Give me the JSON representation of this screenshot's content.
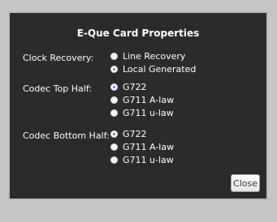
{
  "dialog": {
    "title": "E-Que Card Properties"
  },
  "clock_recovery": {
    "label": "Clock Recovery:",
    "options": [
      {
        "label": "Line Recovery",
        "selected": false
      },
      {
        "label": "Local Generated",
        "selected": true
      }
    ]
  },
  "codec_top_half": {
    "label": "Codec Top Half:",
    "options": [
      {
        "label": "G722",
        "selected": true
      },
      {
        "label": "G711 A-law",
        "selected": false
      },
      {
        "label": "G711 u-law",
        "selected": false
      }
    ]
  },
  "codec_bottom_half": {
    "label": "Codec Bottom Half:",
    "options": [
      {
        "label": "G722",
        "selected": true
      },
      {
        "label": "G711 A-law",
        "selected": false
      },
      {
        "label": "G711 u-law",
        "selected": false
      }
    ]
  },
  "buttons": {
    "close_label": "Close"
  },
  "colors": {
    "dialog_background": "#2b2b2b",
    "page_background": "#c6c6c6",
    "selected_radio_accent": "#4d7cff"
  }
}
